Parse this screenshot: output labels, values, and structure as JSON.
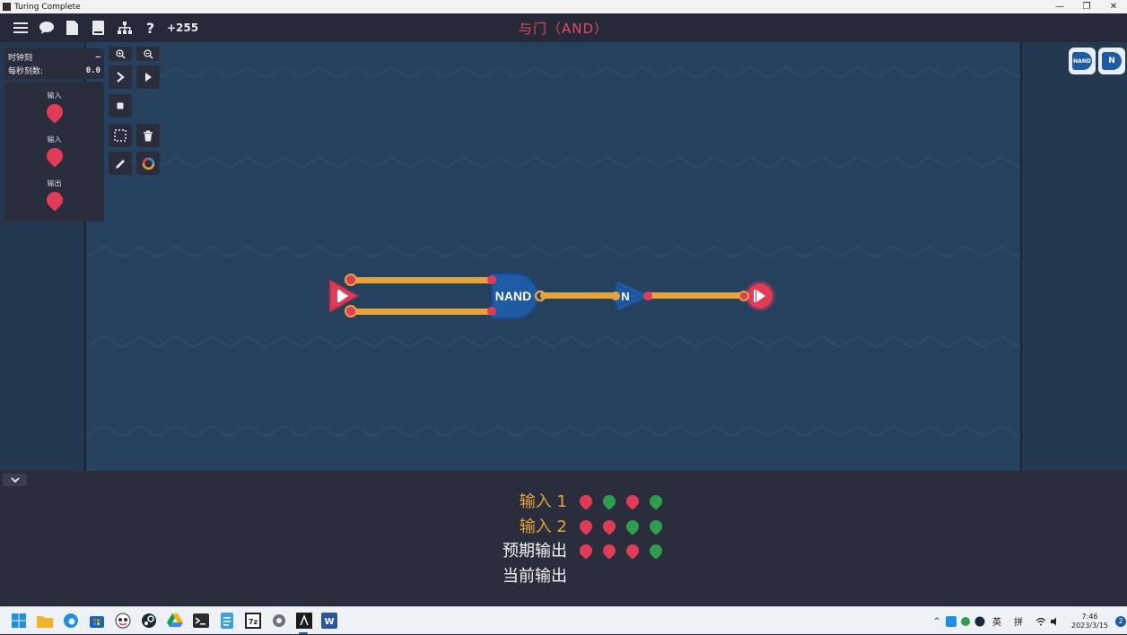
{
  "window": {
    "title": "Turing Complete",
    "controls": [
      "—",
      "❐",
      "✕"
    ]
  },
  "toolbar": {
    "score": "+255",
    "level_title": "与门（AND）"
  },
  "clock_panel": {
    "tick_label": "时钟刻",
    "tick_value": "–",
    "tps_label": "每秒刻数:",
    "tps_value": "0.0"
  },
  "io_panel": {
    "items": [
      {
        "label": "输入"
      },
      {
        "label": "输入"
      },
      {
        "label": "输出"
      }
    ]
  },
  "circuit": {
    "nand_label": "NAND",
    "not_label": "N"
  },
  "components": {
    "nand": "NAND",
    "not": "N"
  },
  "colors": {
    "red": "#e23b57",
    "green": "#2e9e4e",
    "wire": "#e6a33a",
    "title": "#e14a63",
    "gate": "#1f5aa5"
  },
  "truth_table": {
    "rows": [
      {
        "label": "输入 1",
        "color": "#e6a33a",
        "values": [
          0,
          1,
          0,
          1
        ]
      },
      {
        "label": "输入 2",
        "color": "#e6a33a",
        "values": [
          0,
          0,
          1,
          1
        ]
      },
      {
        "label": "预期输出",
        "color": "#f2f2f5",
        "values": [
          0,
          0,
          0,
          1
        ]
      },
      {
        "label": "当前输出",
        "color": "#f2f2f5",
        "values": []
      }
    ]
  },
  "taskbar": {
    "ime_lang": "英",
    "ime_mode": "拼",
    "time": "7:46",
    "date": "2023/3/15",
    "notifications": "2"
  }
}
